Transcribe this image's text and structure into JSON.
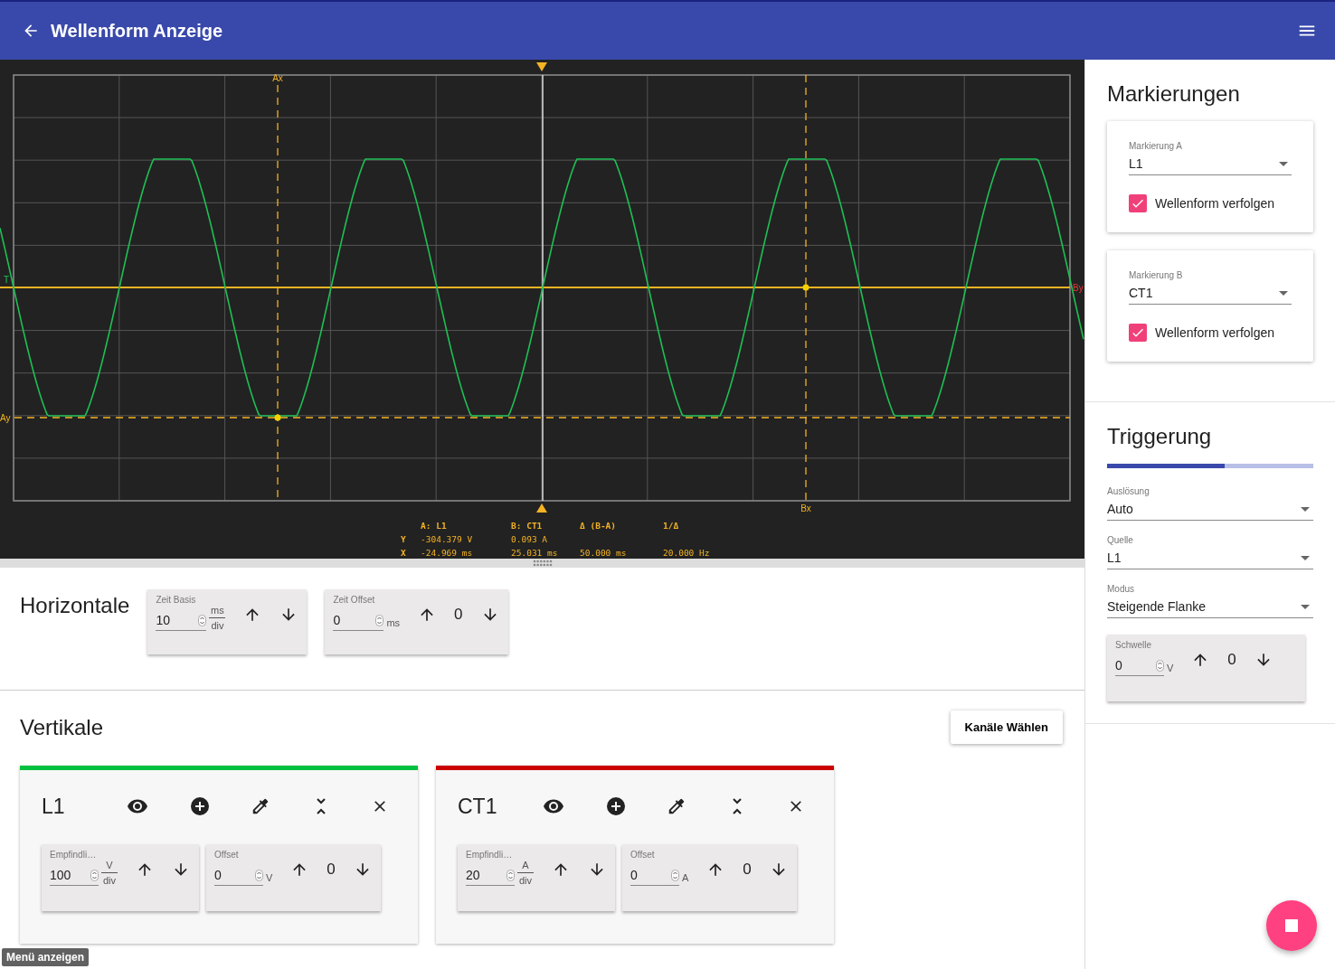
{
  "app_bar": {
    "title": "Wellenform Anzeige"
  },
  "scope": {
    "markers": [
      {
        "kind": "ax",
        "label": "Ax"
      },
      {
        "kind": "bx",
        "label": "Bx"
      },
      {
        "kind": "ay",
        "label": "Ay"
      },
      {
        "kind": "by",
        "label": "By"
      },
      {
        "kind": "trigger",
        "label": "T"
      }
    ],
    "readout": {
      "headers": [
        "A: L1",
        "B: CT1",
        "Δ (B-A)",
        "1/Δ"
      ],
      "rows": [
        {
          "axis": "Y",
          "values": [
            "-304.379 V",
            "0.093 A"
          ]
        },
        {
          "axis": "X",
          "values": [
            "-24.969 ms",
            "25.031 ms",
            "50.000 ms",
            "20.000 Hz"
          ]
        }
      ]
    }
  },
  "horizontal": {
    "title": "Horizontale",
    "controls": [
      {
        "kind": "fraction",
        "label": "Zeit Basis",
        "value": "10",
        "unit_top": "ms",
        "unit_bottom": "div"
      },
      {
        "kind": "offset",
        "label": "Zeit Offset",
        "value": "0",
        "unit": "ms",
        "step": "0"
      }
    ]
  },
  "vertical": {
    "title": "Vertikale",
    "button": "Kanäle Wählen",
    "channels": [
      {
        "name": "L1",
        "color": "#00c040",
        "controls": [
          {
            "kind": "fraction",
            "label": "Empfindli…",
            "value": "100",
            "unit_top": "V",
            "unit_bottom": "div"
          },
          {
            "kind": "offset",
            "label": "Offset",
            "value": "0",
            "unit": "V",
            "step": "0"
          }
        ]
      },
      {
        "name": "CT1",
        "color": "#cc0000",
        "controls": [
          {
            "kind": "fraction",
            "label": "Empfindli…",
            "value": "20",
            "unit_top": "A",
            "unit_bottom": "div"
          },
          {
            "kind": "offset",
            "label": "Offset",
            "value": "0",
            "unit": "A",
            "step": "0"
          }
        ]
      }
    ]
  },
  "sidebar": {
    "markers_title": "Markierungen",
    "markers": [
      {
        "label": "Markierung A",
        "value": "L1",
        "follow_label": "Wellenform verfolgen",
        "checked": true
      },
      {
        "label": "Markierung B",
        "value": "CT1",
        "follow_label": "Wellenform verfolgen",
        "checked": true
      }
    ],
    "trigger": {
      "title": "Triggerung",
      "level": 0.57,
      "selects": [
        {
          "label": "Auslösung",
          "value": "Auto"
        },
        {
          "label": "Quelle",
          "value": "L1"
        },
        {
          "label": "Modus",
          "value": "Steigende Flanke"
        }
      ],
      "threshold": {
        "kind": "offset",
        "label": "Schwelle",
        "value": "0",
        "unit": "V",
        "step": "0"
      }
    }
  },
  "tooltip": "Menü anzeigen"
}
